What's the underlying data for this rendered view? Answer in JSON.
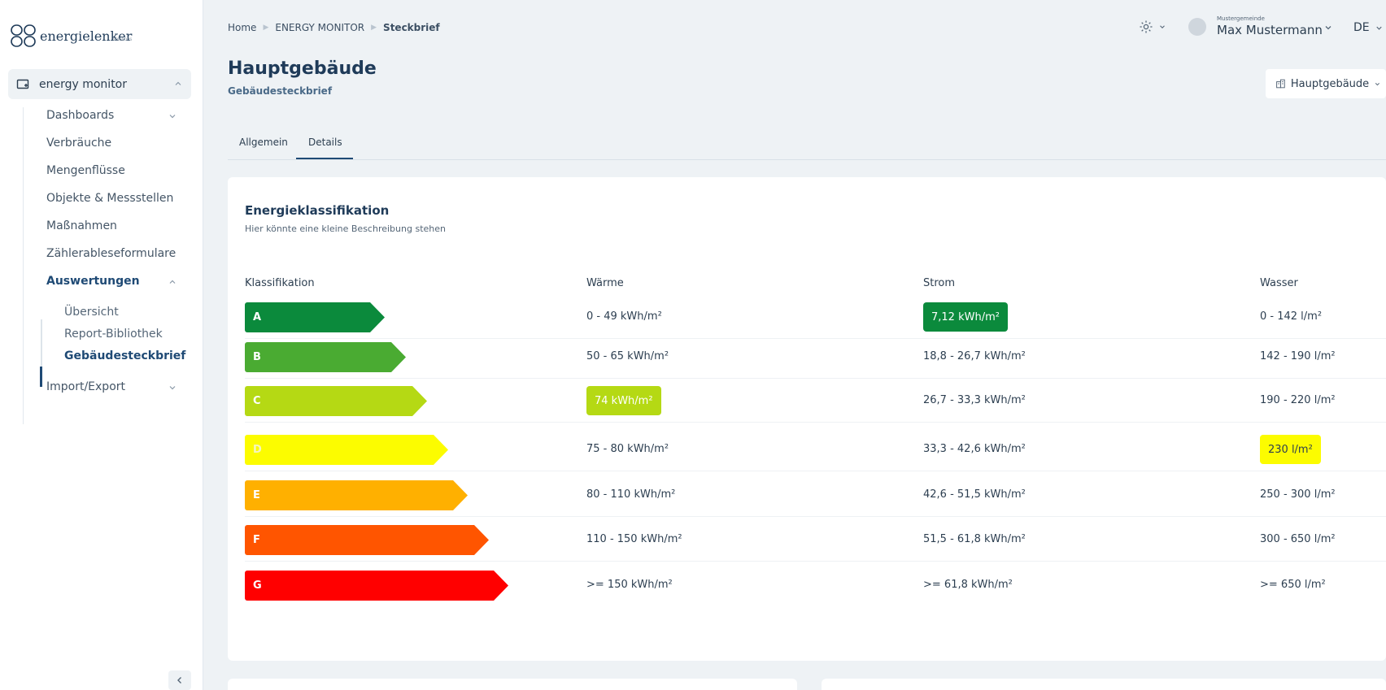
{
  "brand": {
    "name": "energielenker",
    "tagline": "solutions"
  },
  "sidebar": {
    "module_label": "energy monitor",
    "items": [
      {
        "label": "Dashboards",
        "has_chevron": true
      },
      {
        "label": "Verbräuche"
      },
      {
        "label": "Mengenflüsse"
      },
      {
        "label": "Objekte & Messstellen"
      },
      {
        "label": "Maßnahmen"
      },
      {
        "label": "Zählerableseformulare"
      },
      {
        "label": "Auswertungen",
        "active": true,
        "expanded": true
      },
      {
        "label": "Import/Export",
        "has_chevron": true
      }
    ],
    "sub_items": [
      {
        "label": "Übersicht"
      },
      {
        "label": "Report-Bibliothek"
      },
      {
        "label": "Gebäudesteckbrief",
        "active": true
      }
    ]
  },
  "header": {
    "breadcrumb": [
      "Home",
      "ENERGY MONITOR",
      "Steckbrief"
    ],
    "org": "Mustergemeinde",
    "user": "Max Mustermann",
    "language": "DE"
  },
  "page": {
    "title": "Hauptgebäude",
    "subtitle": "Gebäudesteckbrief",
    "building_select": "Hauptgebäude",
    "tabs": [
      {
        "label": "Allgemein"
      },
      {
        "label": "Details",
        "active": true
      }
    ]
  },
  "classification": {
    "title": "Energieklassifikation",
    "description": "Hier könnte eine kleine Beschreibung stehen",
    "columns": [
      "Klassifikation",
      "Wärme",
      "Strom",
      "Wasser"
    ],
    "rows": [
      {
        "class": "A",
        "color": "#0b8a3c",
        "waerme": "0 - 49 kWh/m²",
        "strom": "7,12 kWh/m²",
        "wasser": "0 - 142 l/m²"
      },
      {
        "class": "B",
        "color": "#4aab32",
        "waerme": "50 - 65 kWh/m²",
        "strom": "18,8 - 26,7 kWh/m²",
        "wasser": "142 - 190 l/m²"
      },
      {
        "class": "C",
        "color": "#b5d914",
        "waerme": "74 kWh/m²",
        "strom": "26,7 - 33,3 kWh/m²",
        "wasser": "190 - 220 l/m²"
      },
      {
        "class": "D",
        "color": "#fcfc00",
        "waerme": "75 - 80 kWh/m²",
        "strom": "33,3 - 42,6 kWh/m²",
        "wasser": "230 l/m²"
      },
      {
        "class": "E",
        "color": "#ffb000",
        "waerme": "80 - 110 kWh/m²",
        "strom": "42,6 - 51,5 kWh/m²",
        "wasser": "250 - 300 l/m²"
      },
      {
        "class": "F",
        "color": "#ff5500",
        "waerme": "110 - 150 kWh/m²",
        "strom": "51,5 - 61,8 kWh/m²",
        "wasser": "300 - 650 l/m²"
      },
      {
        "class": "G",
        "color": "#ff0000",
        "waerme": ">= 150 kWh/m²",
        "strom": ">= 61,8 kWh/m²",
        "wasser": ">= 650 l/m²"
      }
    ],
    "highlights": {
      "strom": {
        "row": "A",
        "color": "#0b8a3c",
        "text_color": "#ffffff"
      },
      "waerme": {
        "row": "C",
        "color": "#b5d914",
        "text_color": "#ffffff"
      },
      "wasser": {
        "row": "D",
        "color": "#fcfc00",
        "text_color": "#2c3e50"
      }
    }
  }
}
